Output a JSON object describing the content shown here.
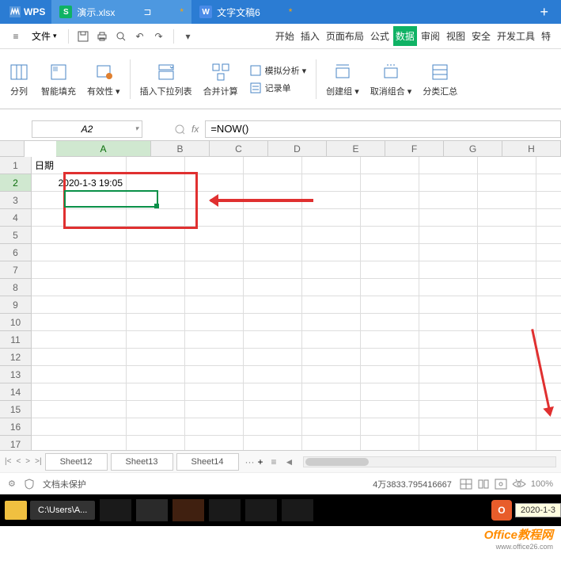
{
  "titlebar": {
    "logo": "WPS",
    "tab1_label": "演示.xlsx",
    "tab1_modified": "*",
    "tab2_label": "文字文稿6",
    "tab2_modified": "*",
    "add": "+"
  },
  "toolbar": {
    "menu_icon": "≡",
    "file_label": "文件",
    "tabs": {
      "start": "开始",
      "insert": "插入",
      "page": "页面布局",
      "formula": "公式",
      "data": "数据",
      "review": "审阅",
      "view": "视图",
      "security": "安全",
      "dev": "开发工具",
      "special": "特"
    }
  },
  "ribbon": {
    "split": "分列",
    "smartfill": "智能填充",
    "validation": "有效性",
    "dropdown": "插入下拉列表",
    "consolidate": "合并计算",
    "simulate": "模拟分析",
    "record": "记录单",
    "group_create": "创建组",
    "group_cancel": "取消组合",
    "subtotal": "分类汇总"
  },
  "formula_bar": {
    "name_box": "A2",
    "fx_label": "fx",
    "formula": "=NOW()"
  },
  "columns": [
    "A",
    "B",
    "C",
    "D",
    "E",
    "F",
    "G",
    "H"
  ],
  "rows": [
    "1",
    "2",
    "3",
    "4",
    "5",
    "6",
    "7",
    "8",
    "9",
    "10",
    "11",
    "12",
    "13",
    "14",
    "15",
    "16",
    "17"
  ],
  "cells": {
    "A1": "日期",
    "A2": "2020-1-3 19:05"
  },
  "sheets": {
    "nav_first": "|<",
    "nav_prev": "<",
    "nav_next": ">",
    "nav_last": ">|",
    "tabs": [
      "Sheet12",
      "Sheet13",
      "Sheet14"
    ],
    "more": "···",
    "add": "+"
  },
  "statusbar": {
    "protect": "文档未保护",
    "value": "4万3833.795416667",
    "zoom": "100%"
  },
  "taskbar": {
    "path": "C:\\Users\\A...",
    "tooltip": "2020-1-3"
  },
  "watermark": {
    "line1": "Office教程网",
    "line2": "www.office26.com"
  }
}
